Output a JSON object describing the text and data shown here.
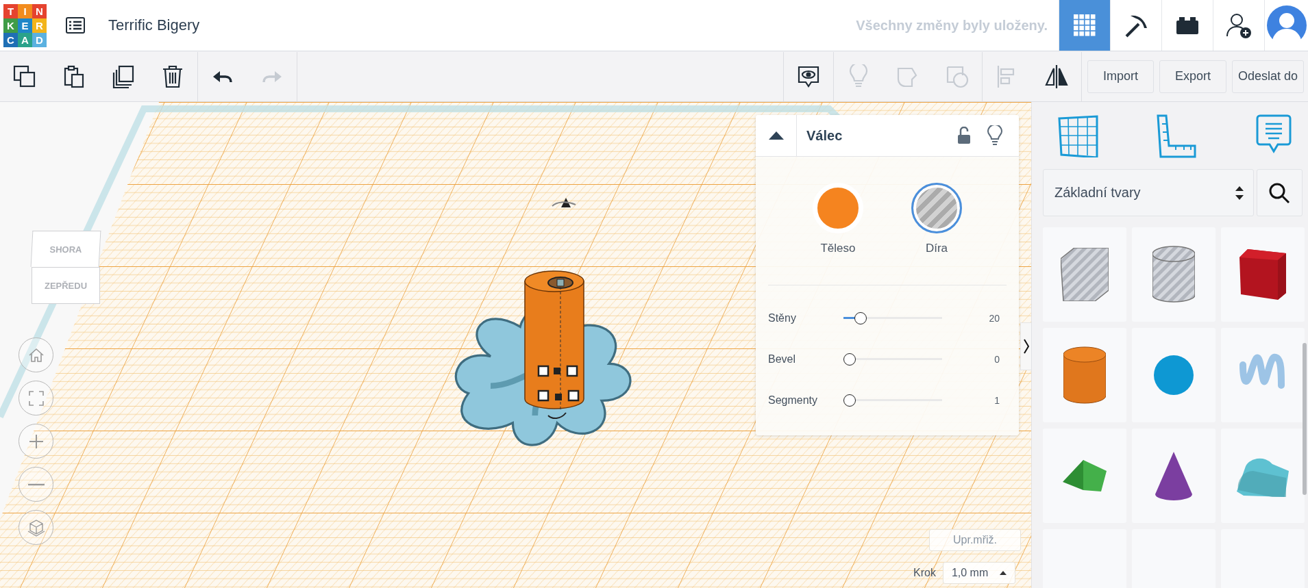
{
  "logo": {
    "letters": [
      {
        "char": "T",
        "color": "#e5432f"
      },
      {
        "char": "I",
        "color": "#f28c1e"
      },
      {
        "char": "N",
        "color": "#e5432f"
      },
      {
        "char": "K",
        "color": "#3f9c47"
      },
      {
        "char": "E",
        "color": "#1f86c8"
      },
      {
        "char": "R",
        "color": "#f2b41b"
      },
      {
        "char": "C",
        "color": "#1f6fb5"
      },
      {
        "char": "A",
        "color": "#2aa28a"
      },
      {
        "char": "D",
        "color": "#5bb1e0"
      }
    ]
  },
  "header": {
    "title": "Terrific Bigery",
    "save_status": "Všechny změny byly uloženy.",
    "tools": [
      {
        "kind": "grid",
        "selected": true
      },
      {
        "kind": "pickaxe",
        "selected": false
      },
      {
        "kind": "bricks",
        "selected": false
      }
    ]
  },
  "toolbar": {
    "left": [
      {
        "kind": "copy",
        "disabled": false
      },
      {
        "kind": "paste",
        "disabled": false
      },
      {
        "kind": "duplicate",
        "disabled": false
      },
      {
        "kind": "delete",
        "disabled": false
      },
      {
        "kind": "undo",
        "disabled": false
      },
      {
        "kind": "redo",
        "disabled": true
      }
    ],
    "right": [
      {
        "kind": "note",
        "disabled": false
      },
      {
        "kind": "bulb",
        "disabled": true
      },
      {
        "kind": "group",
        "disabled": true
      },
      {
        "kind": "ungroup",
        "disabled": true
      },
      {
        "kind": "align",
        "disabled": true
      },
      {
        "kind": "mirror",
        "disabled": false
      }
    ],
    "buttons": [
      "Import",
      "Export",
      "Odeslat do"
    ]
  },
  "view_cube": {
    "top": "SHORA",
    "front": "ZEPŘEDU"
  },
  "shape_panel": {
    "title": "Válec",
    "modes": [
      {
        "label": "Těleso",
        "kind": "solid",
        "selected": false
      },
      {
        "label": "Díra",
        "kind": "hole",
        "selected": true
      }
    ],
    "params": [
      {
        "label": "Stěny",
        "value": "20",
        "level": 0.13
      },
      {
        "label": "Bevel",
        "value": "0",
        "level": 0
      },
      {
        "label": "Segmenty",
        "value": "1",
        "level": 0
      }
    ]
  },
  "grid_controls": {
    "edit_grid": "Upr.mřiž.",
    "snap_label": "Krok",
    "snap_value": "1,0 mm"
  },
  "sidebar": {
    "category": "Základní tvary",
    "shapes": [
      {
        "kind": "box-hole"
      },
      {
        "kind": "cylinder-hole"
      },
      {
        "kind": "box"
      },
      {
        "kind": "cylinder"
      },
      {
        "kind": "sphere"
      },
      {
        "kind": "scribble"
      },
      {
        "kind": "roof"
      },
      {
        "kind": "cone"
      },
      {
        "kind": "round-roof"
      },
      {
        "kind": "empty"
      },
      {
        "kind": "empty"
      },
      {
        "kind": "empty"
      }
    ]
  }
}
